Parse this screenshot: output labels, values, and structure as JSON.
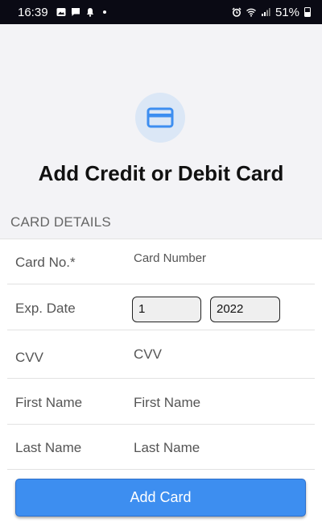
{
  "status_bar": {
    "time": "16:39",
    "battery": "51%"
  },
  "header": {
    "title": "Add Credit or Debit Card",
    "icon": "credit-card-icon",
    "accent": "#3d8ef0"
  },
  "section": {
    "label": "CARD DETAILS"
  },
  "form": {
    "card_number": {
      "label": "Card No.*",
      "placeholder": "Card Number"
    },
    "expiry": {
      "label": "Exp. Date",
      "month": "1",
      "year": "2022"
    },
    "cvv": {
      "label": "CVV",
      "placeholder": "CVV"
    },
    "first_name": {
      "label": "First Name",
      "placeholder": "First Name"
    },
    "last_name": {
      "label": "Last Name",
      "placeholder": "Last Name"
    }
  },
  "actions": {
    "add_card": "Add Card"
  }
}
